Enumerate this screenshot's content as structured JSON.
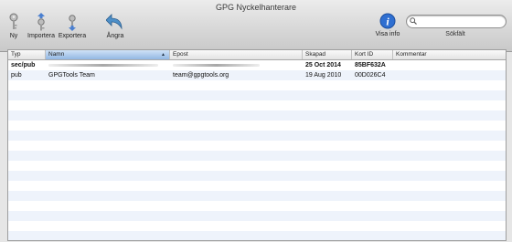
{
  "window": {
    "title": "GPG Nyckelhanterare"
  },
  "toolbar": {
    "new_label": "Ny",
    "import_label": "Importera",
    "export_label": "Exportera",
    "undo_label": "Ångra",
    "info_label": "Visa info"
  },
  "search": {
    "value": "",
    "placeholder": "",
    "label": "Sökfält"
  },
  "table": {
    "columns": [
      "Typ",
      "Namn",
      "Epost",
      "Skapad",
      "Kort ID",
      "Kommentar"
    ],
    "sorted_column": "Namn",
    "rows": [
      {
        "type": "sec/pub",
        "name": "",
        "email": "",
        "created": "25 Oct 2014",
        "short_id": "85BF632A",
        "comment": "",
        "bold": true
      },
      {
        "type": "pub",
        "name": "GPGTools Team",
        "email": "team@gpgtools.org",
        "created": "19 Aug 2010",
        "short_id": "00D026C4",
        "comment": "",
        "bold": false
      }
    ]
  },
  "colors": {
    "selected_header": "#a8c6ec",
    "row_stripe": "#eef3fb",
    "info_icon": "#2f6fd1"
  }
}
